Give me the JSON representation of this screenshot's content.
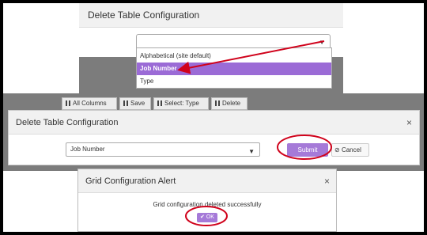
{
  "panel1": {
    "title": "Delete Table Configuration",
    "options": [
      "Alphabetical (site default)",
      "Job Number",
      "Type"
    ]
  },
  "toolbar": {
    "all_columns": "All Columns",
    "save": "Save",
    "select_type": "Select: Type",
    "delete": "Delete"
  },
  "panel2": {
    "title": "Delete Table Configuration",
    "close": "×",
    "selected": "Job Number",
    "submit": "Submit",
    "cancel": "Cancel",
    "cancel_icon": "⊘"
  },
  "panel3": {
    "title": "Grid Configuration Alert",
    "close": "×",
    "message": "Grid configuration deleted successfully",
    "ok": "OK",
    "ok_icon": "✔"
  },
  "colors": {
    "accent": "#a57ad8",
    "highlight": "#9b6bd6",
    "annotation": "#d0021b"
  }
}
